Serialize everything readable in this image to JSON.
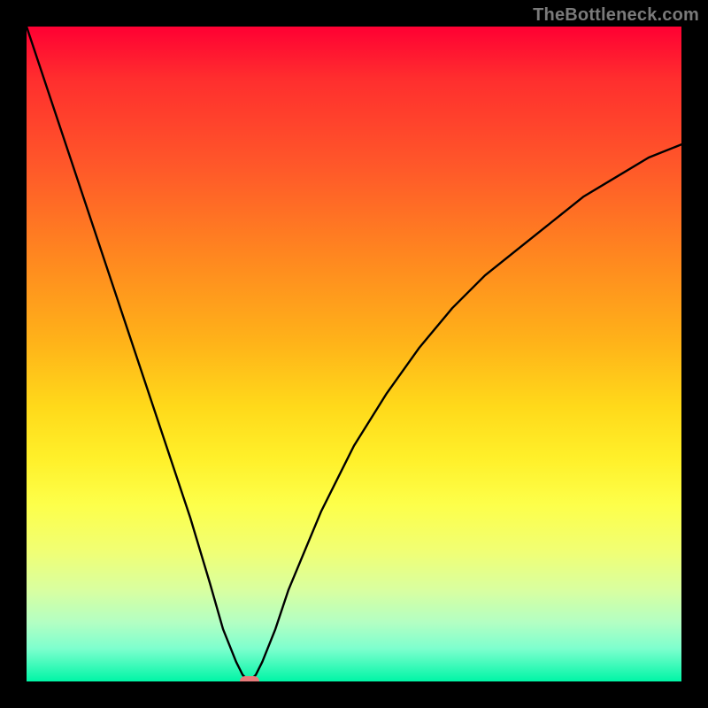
{
  "watermark": "TheBottleneck.com",
  "chart_data": {
    "type": "line",
    "title": "",
    "xlabel": "",
    "ylabel": "",
    "xlim": [
      0,
      100
    ],
    "ylim": [
      0,
      100
    ],
    "grid": false,
    "legend": false,
    "background": {
      "type": "vertical-gradient",
      "stops": [
        {
          "pos": 0,
          "color": "#ff0033"
        },
        {
          "pos": 22,
          "color": "#ff5a29"
        },
        {
          "pos": 48,
          "color": "#ffb219"
        },
        {
          "pos": 66,
          "color": "#fff02a"
        },
        {
          "pos": 86,
          "color": "#d9ffa0"
        },
        {
          "pos": 100,
          "color": "#00f5a6"
        }
      ]
    },
    "series": [
      {
        "name": "bottleneck-curve",
        "color": "#000000",
        "x": [
          0,
          5,
          10,
          15,
          20,
          25,
          28,
          30,
          32,
          33,
          34,
          35,
          36,
          38,
          40,
          45,
          50,
          55,
          60,
          65,
          70,
          75,
          80,
          85,
          90,
          95,
          100
        ],
        "y": [
          100,
          85,
          70,
          55,
          40,
          25,
          15,
          8,
          3,
          1,
          0,
          1,
          3,
          8,
          14,
          26,
          36,
          44,
          51,
          57,
          62,
          66,
          70,
          74,
          77,
          80,
          82
        ]
      }
    ],
    "markers": [
      {
        "name": "min-marker",
        "x": 34,
        "y": 0,
        "color": "#e77a7a",
        "shape": "pill"
      }
    ],
    "minimum": {
      "x": 34,
      "y": 0
    }
  },
  "colors": {
    "frame": "#000000",
    "curve": "#000000",
    "marker": "#e77a7a",
    "watermark": "#7a7a7a"
  }
}
